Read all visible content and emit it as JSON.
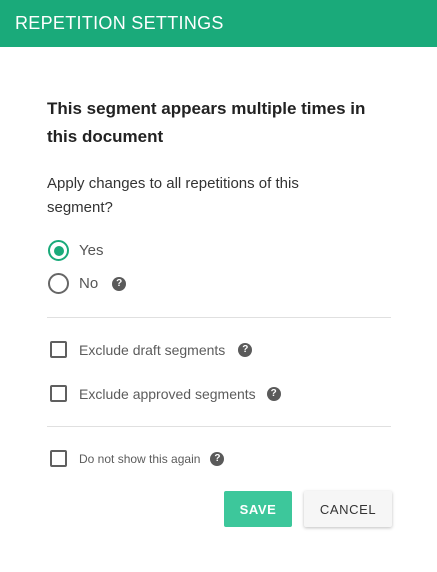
{
  "dialog": {
    "title": "REPETITION SETTINGS",
    "heading": "This segment appears multiple times in this document",
    "question": "Apply changes to all repetitions of this segment?"
  },
  "radios": [
    {
      "label": "Yes",
      "checked": true
    },
    {
      "label": "No",
      "checked": false
    }
  ],
  "checkboxes": {
    "exclude_draft": {
      "label": "Exclude draft segments",
      "checked": false
    },
    "exclude_approved": {
      "label": "Exclude approved segments",
      "checked": false
    },
    "do_not_show": {
      "label": "Do not show this again",
      "checked": false
    }
  },
  "help_glyph": "?",
  "buttons": {
    "save": "SAVE",
    "cancel": "CANCEL"
  },
  "colors": {
    "header": "#1aaa7a",
    "accent": "#1aaa7a",
    "save_button": "#3dc79b"
  },
  "icons": [
    "radio-checked-icon",
    "radio-unchecked-icon",
    "help-icon",
    "checkbox-icon"
  ]
}
